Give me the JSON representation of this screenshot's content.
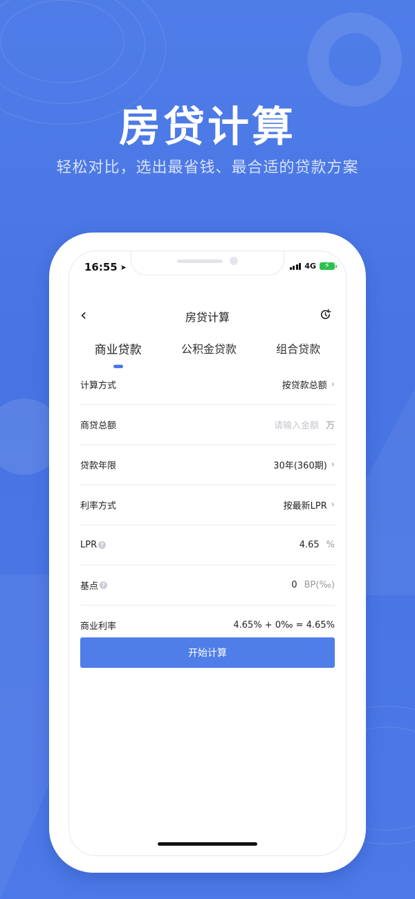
{
  "promo": {
    "headline": "房贷计算",
    "subline": "轻松对比，选出最省钱、最合适的贷款方案"
  },
  "status_bar": {
    "time": "16:55",
    "network": "4G"
  },
  "navbar": {
    "back_label": "‹",
    "title": "房贷计算"
  },
  "tabs": [
    {
      "label": "商业贷款",
      "active": true
    },
    {
      "label": "公积金贷款",
      "active": false
    },
    {
      "label": "组合贷款",
      "active": false
    }
  ],
  "form": {
    "calc_method": {
      "label": "计算方式",
      "value": "按贷款总额"
    },
    "loan_amount": {
      "label": "商贷总额",
      "placeholder": "请输入金额",
      "unit": "万"
    },
    "loan_term": {
      "label": "贷款年限",
      "value": "30年(360期)"
    },
    "rate_method": {
      "label": "利率方式",
      "value": "按最新LPR"
    },
    "lpr": {
      "label": "LPR",
      "value": "4.65",
      "unit": "%"
    },
    "basis_point": {
      "label": "基点",
      "value": "0",
      "unit": "BP(‰)"
    },
    "commercial_rate": {
      "label": "商业利率",
      "value": "4.65% + 0‰ = 4.65%"
    }
  },
  "buttons": {
    "calculate": "开始计算"
  },
  "colors": {
    "background": "#4a78e6",
    "accent": "#4f7ee8",
    "battery": "#2cc24f"
  }
}
